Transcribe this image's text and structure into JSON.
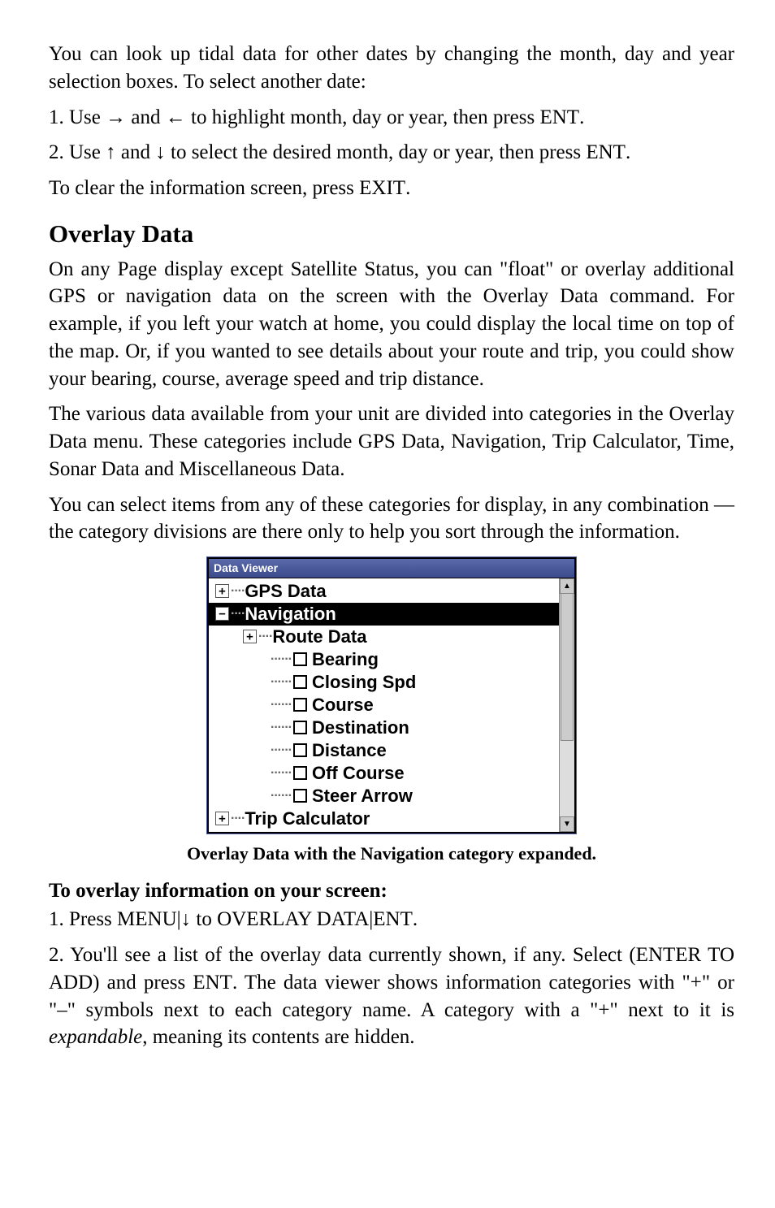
{
  "para1": "You can look up tidal data for other dates by changing the month, day and year selection boxes. To select another date:",
  "step1a": "1. Use ",
  "arrow_r": "→",
  "andword": " and ",
  "arrow_l": "←",
  "step1b": " to highlight month, day or year, then press ",
  "ent": "ENT",
  "period": ".",
  "step2a": "2. Use ",
  "arrow_u": "↑",
  "arrow_d": "↓",
  "step2b": " to select the desired month, day or year, then press ",
  "clear_a": "To clear the information screen, press ",
  "exit": "EXIT",
  "h2": "Overlay Data",
  "od_p1": "On any Page display except Satellite Status, you can \"float\" or overlay additional GPS or navigation data on the screen with the Overlay Data command. For example, if you left your watch at home, you could display the local time on top of the map. Or, if you wanted to see details about your route and trip, you could show your bearing, course, average speed and trip distance.",
  "od_p2": "The various data available from your unit are divided into categories in the Overlay Data menu. These categories include GPS Data, Navigation, Trip Calculator, Time, Sonar Data and Miscellaneous Data.",
  "od_p3": "You can select items from any of these categories for display, in any combination — the category divisions are there only to help you sort through the information.",
  "figure": {
    "titlebar": "Data Viewer",
    "rows": {
      "r0": "GPS Data",
      "r1": "Navigation",
      "r2": "Route Data",
      "r3": "Bearing",
      "r4": "Closing Spd",
      "r5": "Course",
      "r6": "Destination",
      "r7": "Distance",
      "r8": "Off Course",
      "r9": "Steer Arrow",
      "r10": "Trip Calculator"
    }
  },
  "caption": "Overlay Data with the Navigation category expanded.",
  "howto_h": "To overlay information on your screen:",
  "how1a": "1. Press ",
  "menu": "MENU",
  "bar": "|",
  "how1b": " to ",
  "ov_label": "OVERLAY DATA",
  "how2": "2. You'll see a list of the overlay data currently shown, if any. Select ",
  "enter_label": "(ENTER TO ADD)",
  "how2b": " and press ",
  "how2c": ". The data viewer shows information categories with \"+\" or \"–\" symbols next to each category name. A category with a \"+\" next to it is ",
  "expandable": "expandable",
  "how2d": ", meaning its contents are hidden."
}
